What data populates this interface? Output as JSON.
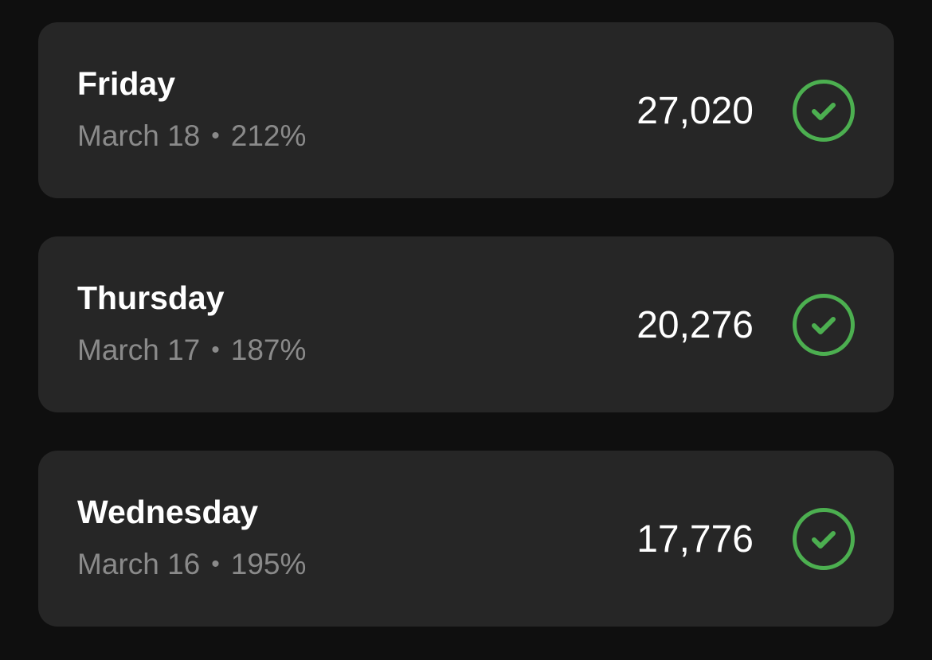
{
  "theme": {
    "background": "#0f0f0f",
    "card_background": "#262626",
    "primary_text": "#ffffff",
    "secondary_text": "#8a8a8a",
    "success_accent": "#4caf50"
  },
  "separator": "•",
  "days": [
    {
      "day": "Friday",
      "date": "March 18",
      "percent": "212%",
      "steps": "27,020",
      "status_icon": "check-circle-icon"
    },
    {
      "day": "Thursday",
      "date": "March 17",
      "percent": "187%",
      "steps": "20,276",
      "status_icon": "check-circle-icon"
    },
    {
      "day": "Wednesday",
      "date": "March 16",
      "percent": "195%",
      "steps": "17,776",
      "status_icon": "check-circle-icon"
    }
  ]
}
